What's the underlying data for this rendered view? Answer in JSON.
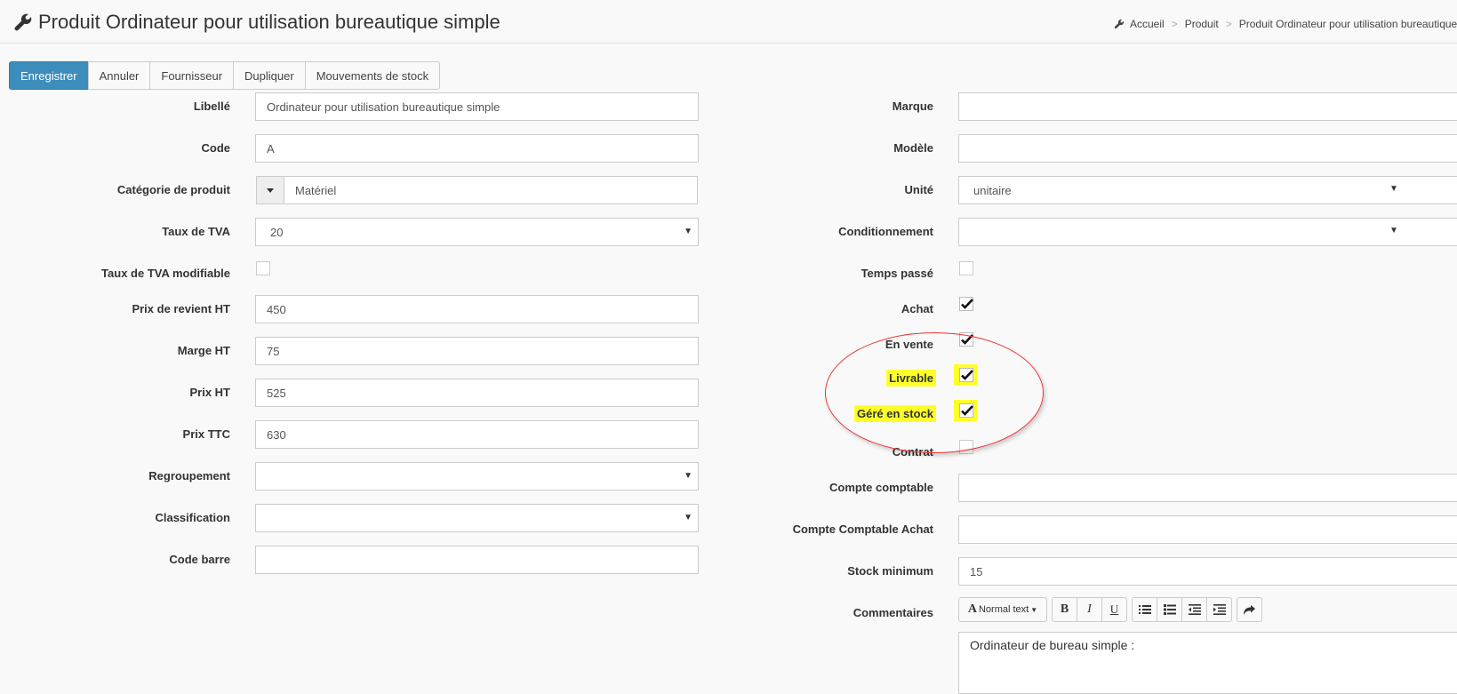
{
  "header": {
    "title": "Produit Ordinateur pour utilisation bureautique simple",
    "title_icon": "wrench-icon",
    "breadcrumb": [
      "Accueil",
      "Produit",
      "Produit Ordinateur pour utilisation bureautique simple"
    ]
  },
  "toolbar": {
    "save": "Enregistrer",
    "cancel": "Annuler",
    "supplier": "Fournisseur",
    "duplicate": "Dupliquer",
    "stock_movements": "Mouvements de stock",
    "accent_color": "#3c8dbc"
  },
  "left": {
    "libelle": {
      "label": "Libellé",
      "value": "Ordinateur pour utilisation bureautique simple"
    },
    "code": {
      "label": "Code",
      "value": "A"
    },
    "categorie": {
      "label": "Catégorie de produit",
      "value": "Matériel"
    },
    "tva": {
      "label": "Taux de TVA",
      "value": "20"
    },
    "tva_modifiable": {
      "label": "Taux de TVA modifiable",
      "checked": false
    },
    "prix_revient": {
      "label": "Prix de revient HT",
      "value": "450"
    },
    "marge": {
      "label": "Marge HT",
      "value": "75"
    },
    "prix_ht": {
      "label": "Prix HT",
      "value": "525"
    },
    "prix_ttc": {
      "label": "Prix TTC",
      "value": "630"
    },
    "regroupement": {
      "label": "Regroupement",
      "value": ""
    },
    "classification": {
      "label": "Classification",
      "value": ""
    },
    "code_barre": {
      "label": "Code barre",
      "value": ""
    }
  },
  "right": {
    "marque": {
      "label": "Marque",
      "value": ""
    },
    "modele": {
      "label": "Modèle",
      "value": ""
    },
    "unite": {
      "label": "Unité",
      "value": "unitaire"
    },
    "conditionnement": {
      "label": "Conditionnement",
      "value": ""
    },
    "temps_passe": {
      "label": "Temps passé",
      "checked": false
    },
    "achat": {
      "label": "Achat",
      "checked": true
    },
    "en_vente": {
      "label": "En vente",
      "checked": true
    },
    "livrable": {
      "label": "Livrable",
      "checked": true
    },
    "gere_stock": {
      "label": "Géré en stock",
      "checked": true
    },
    "contrat": {
      "label": "Contrat",
      "checked": false
    },
    "compte_comptable": {
      "label": "Compte comptable",
      "value": ""
    },
    "compte_achat": {
      "label": "Compte Comptable Achat",
      "value": ""
    },
    "stock_minimum": {
      "label": "Stock minimum",
      "value": "15"
    },
    "commentaires": {
      "label": "Commentaires",
      "text_style": "Normal text",
      "value": "Ordinateur de bureau simple :"
    }
  },
  "annotation": {
    "highlight_color": "#ffff2a",
    "circle_color": "#e33333"
  }
}
